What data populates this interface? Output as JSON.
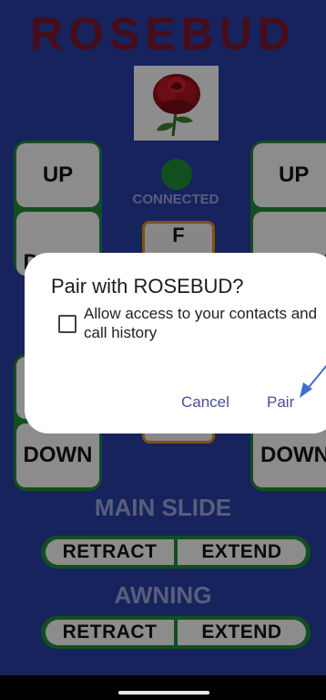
{
  "app": {
    "title": "ROSEBUD",
    "status": "CONNECTED",
    "f_button": "F"
  },
  "pads": {
    "up_label": "UP",
    "down_label": "DOWN"
  },
  "main_slide": {
    "heading": "MAIN SLIDE",
    "retract": "RETRACT",
    "extend": "EXTEND"
  },
  "awning": {
    "heading": "AWNING",
    "retract": "RETRACT",
    "extend": "EXTEND"
  },
  "dialog": {
    "title": "Pair with ROSEBUD?",
    "checkbox_label": "Allow access to your contacts and call history",
    "cancel": "Cancel",
    "pair": "Pair"
  },
  "colors": {
    "background": "#223690",
    "title": "#6e1328",
    "pad_border": "#1d7a2e",
    "accent_text": "#4b4d9a",
    "arrow": "#3f6fd1"
  }
}
